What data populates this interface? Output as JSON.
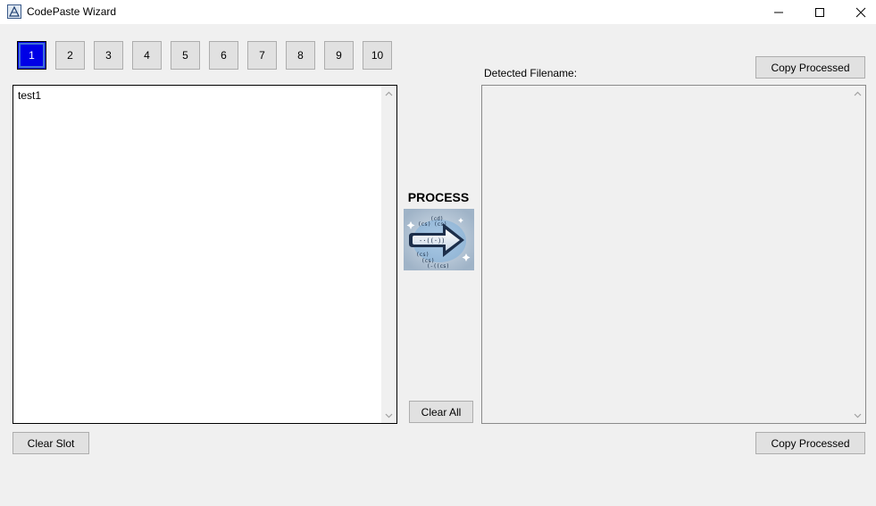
{
  "window": {
    "title": "CodePaste Wizard"
  },
  "slots": [
    {
      "label": "1",
      "active": true
    },
    {
      "label": "2",
      "active": false
    },
    {
      "label": "3",
      "active": false
    },
    {
      "label": "4",
      "active": false
    },
    {
      "label": "5",
      "active": false
    },
    {
      "label": "6",
      "active": false
    },
    {
      "label": "7",
      "active": false
    },
    {
      "label": "8",
      "active": false
    },
    {
      "label": "9",
      "active": false
    },
    {
      "label": "10",
      "active": false
    }
  ],
  "input": {
    "text": "test1"
  },
  "output": {
    "detected_filename_label": "Detected Filename:",
    "text": ""
  },
  "center": {
    "process_label": "PROCESS",
    "process_icon": "arrow-right-icon",
    "clear_all_label": "Clear All"
  },
  "buttons": {
    "clear_slot_label": "Clear Slot",
    "copy_processed_top_label": "Copy Processed",
    "copy_processed_bottom_label": "Copy Processed"
  },
  "colors": {
    "active_slot": "#0000e6",
    "window_bg": "#f0f0f0"
  }
}
